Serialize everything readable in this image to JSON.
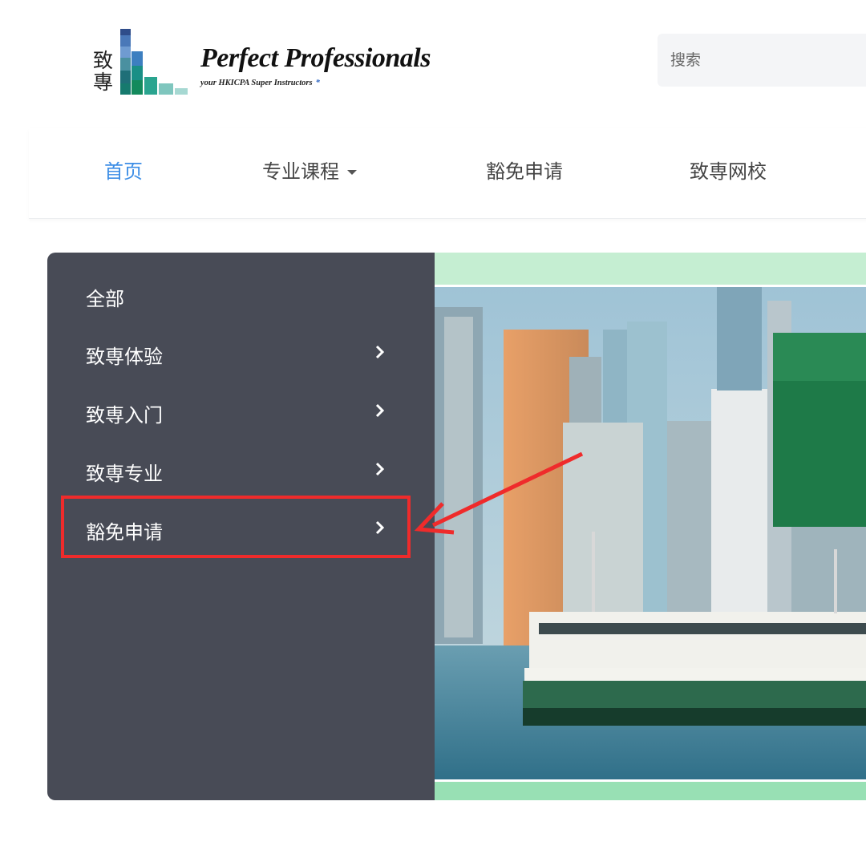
{
  "header": {
    "logo": {
      "chars": [
        "致",
        "專"
      ],
      "title": "Perfect Professionals",
      "tagline": "your HKICPA Super Instructors",
      "tagline_mark": "*"
    },
    "search": {
      "placeholder": "搜索"
    }
  },
  "nav": {
    "items": [
      {
        "label": "首页",
        "active": true
      },
      {
        "label": "专业课程",
        "has_dropdown": true
      },
      {
        "label": "豁免申请"
      },
      {
        "label": "致専网校"
      }
    ]
  },
  "categories": {
    "items": [
      {
        "label": "全部",
        "has_submenu": false
      },
      {
        "label": "致専体验",
        "has_submenu": true
      },
      {
        "label": "致専入门",
        "has_submenu": true
      },
      {
        "label": "致専专业",
        "has_submenu": true
      },
      {
        "label": "豁免申请",
        "has_submenu": true,
        "highlighted": true
      }
    ]
  },
  "colors": {
    "nav_active": "#3d8ee6",
    "sidebar_bg": "#484b56",
    "annotation_red": "#ef2b2b",
    "logo_teal": "#1a8f86"
  },
  "icons": {
    "chevron": "chevron-right-icon",
    "caret": "caret-down-icon",
    "arrow": "annotation-arrow-icon"
  }
}
